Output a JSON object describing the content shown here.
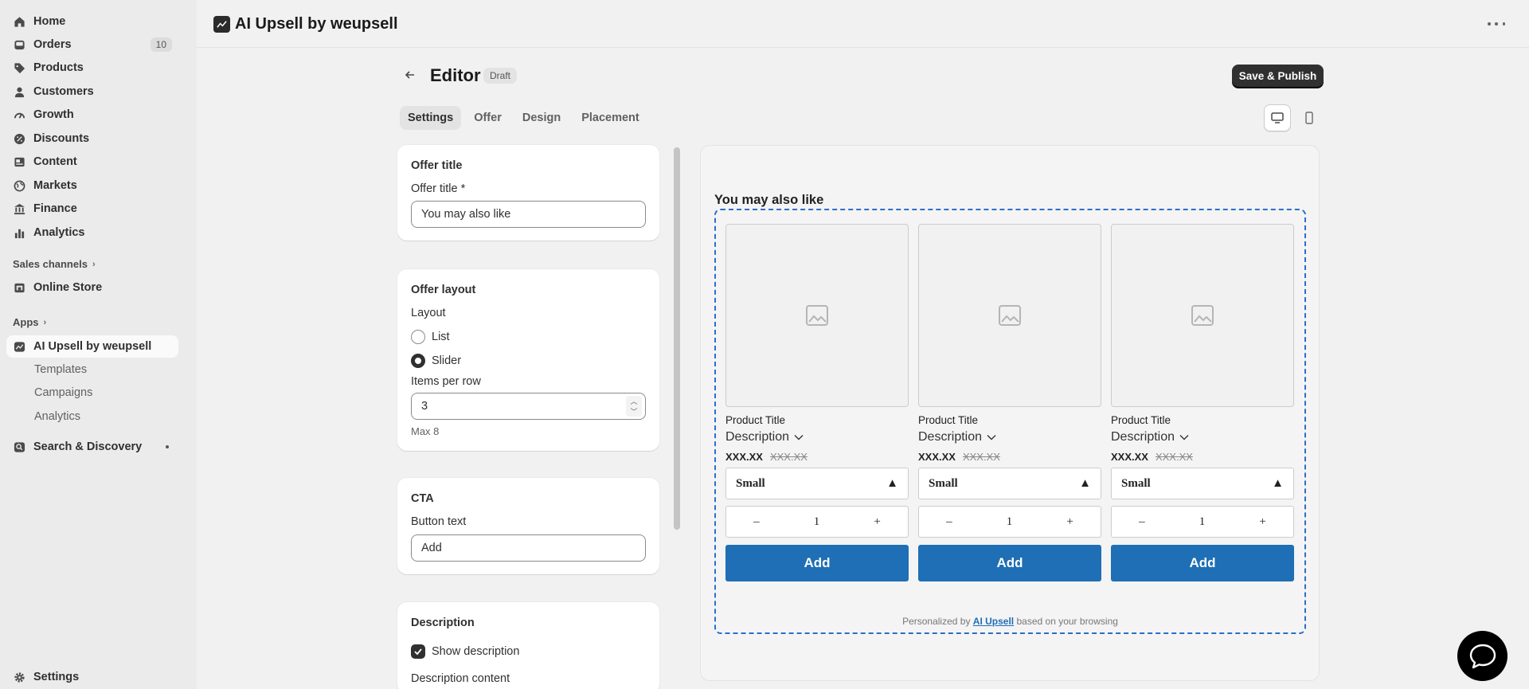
{
  "sidebar": {
    "items": [
      {
        "label": "Home",
        "icon": "home-icon"
      },
      {
        "label": "Orders",
        "icon": "inbox-icon",
        "badge": "10"
      },
      {
        "label": "Products",
        "icon": "tag-icon"
      },
      {
        "label": "Customers",
        "icon": "person-icon"
      },
      {
        "label": "Growth",
        "icon": "gauge-icon"
      },
      {
        "label": "Discounts",
        "icon": "discount-icon"
      },
      {
        "label": "Content",
        "icon": "content-icon"
      },
      {
        "label": "Markets",
        "icon": "globe-icon"
      },
      {
        "label": "Finance",
        "icon": "bank-icon"
      },
      {
        "label": "Analytics",
        "icon": "bar-chart-icon"
      }
    ],
    "sales_channels": "Sales channels",
    "online_store": "Online Store",
    "apps": "Apps",
    "app_name": "AI Upsell by weupsell",
    "app_sub": [
      "Templates",
      "Campaigns",
      "Analytics"
    ],
    "search_discovery": "Search & Discovery",
    "settings": "Settings"
  },
  "topbar": {
    "title": "AI Upsell by weupsell"
  },
  "editor": {
    "title": "Editor",
    "badge": "Draft",
    "publish": "Save & Publish",
    "tabs": [
      "Settings",
      "Offer",
      "Design",
      "Placement"
    ],
    "active_tab": "Settings"
  },
  "settings": {
    "offer_title_card": {
      "heading": "Offer title",
      "label": "Offer title *",
      "value": "You may also like"
    },
    "layout_card": {
      "heading": "Offer layout",
      "layout_label": "Layout",
      "options": [
        "List",
        "Slider"
      ],
      "selected": "Slider",
      "items_label": "Items per row",
      "items_value": "3",
      "help": "Max 8"
    },
    "cta_card": {
      "heading": "CTA",
      "label": "Button text",
      "value": "Add"
    },
    "description_card": {
      "heading": "Description",
      "checkbox": "Show description",
      "checked": true,
      "content_label": "Description content"
    }
  },
  "preview": {
    "heading": "You may also like",
    "products": [
      {
        "title": "Product Title",
        "description": "Description",
        "price": "XXX.XX",
        "compare": "XXX.XX",
        "variant": "Small",
        "qty": "1",
        "button": "Add"
      },
      {
        "title": "Product Title",
        "description": "Description",
        "price": "XXX.XX",
        "compare": "XXX.XX",
        "variant": "Small",
        "qty": "1",
        "button": "Add"
      },
      {
        "title": "Product Title",
        "description": "Description",
        "price": "XXX.XX",
        "compare": "XXX.XX",
        "variant": "Small",
        "qty": "1",
        "button": "Add"
      }
    ],
    "footer_prefix": "Personalized by",
    "footer_link": "AI Upsell",
    "footer_suffix": "based on your browsing",
    "qty_minus": "–",
    "qty_plus": "+"
  },
  "colors": {
    "accent": "#1e6fb5",
    "dashed_border": "#2c6ecb",
    "primary_button": "#303030"
  }
}
